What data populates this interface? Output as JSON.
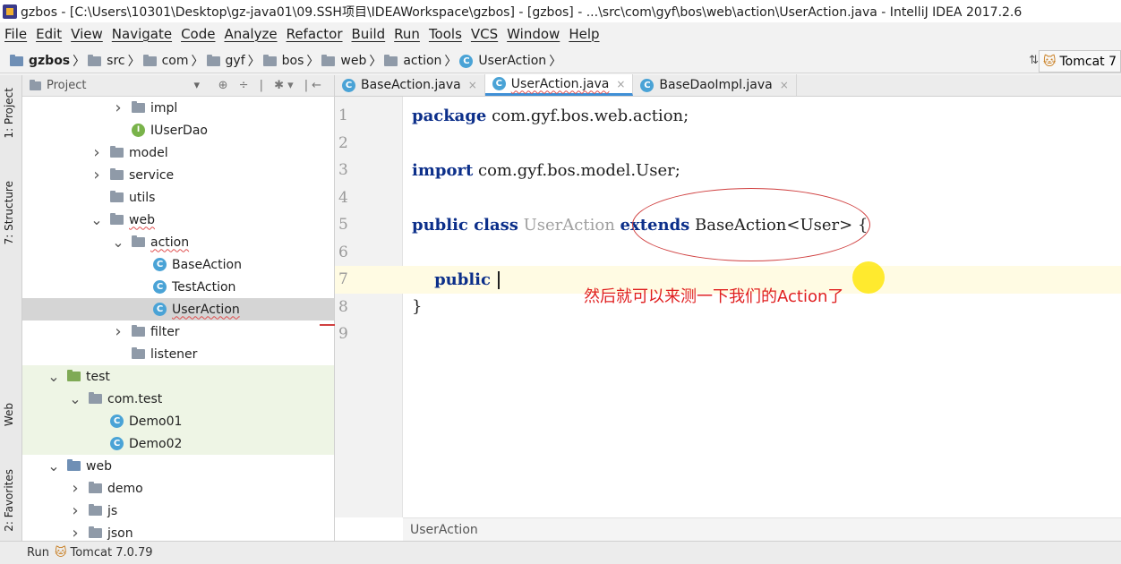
{
  "window": {
    "title": "gzbos - [C:\\Users\\10301\\Desktop\\gz-java01\\09.SSH项目\\IDEAWorkspace\\gzbos] - [gzbos] - ...\\src\\com\\gyf\\bos\\web\\action\\UserAction.java - IntelliJ IDEA 2017.2.6"
  },
  "menu": [
    "File",
    "Edit",
    "View",
    "Navigate",
    "Code",
    "Analyze",
    "Refactor",
    "Build",
    "Run",
    "Tools",
    "VCS",
    "Window",
    "Help"
  ],
  "breadcrumb": [
    "gzbos",
    "src",
    "com",
    "gyf",
    "bos",
    "web",
    "action",
    "UserAction"
  ],
  "run_config": "Tomcat 7",
  "left_tabs": {
    "project": "1: Project",
    "structure": "7: Structure",
    "web": "Web",
    "favorites": "2: Favorites"
  },
  "project_panel": {
    "title": "Project"
  },
  "tree": [
    {
      "label": "impl",
      "icon": "folder",
      "indent": 100,
      "arrow": ">"
    },
    {
      "label": "IUserDao",
      "icon": "interface",
      "indent": 122,
      "arrow": ""
    },
    {
      "label": "model",
      "icon": "folder",
      "indent": 76,
      "arrow": ">"
    },
    {
      "label": "service",
      "icon": "folder",
      "indent": 76,
      "arrow": ">"
    },
    {
      "label": "utils",
      "icon": "folder",
      "indent": 98,
      "arrow": ""
    },
    {
      "label": "web",
      "icon": "folder",
      "indent": 76,
      "arrow": "v"
    },
    {
      "label": "action",
      "icon": "folder",
      "indent": 100,
      "arrow": "v"
    },
    {
      "label": "BaseAction",
      "icon": "class",
      "indent": 146,
      "arrow": ""
    },
    {
      "label": "TestAction",
      "icon": "class",
      "indent": 146,
      "arrow": ""
    },
    {
      "label": "UserAction",
      "icon": "class",
      "indent": 146,
      "arrow": ""
    },
    {
      "label": "filter",
      "icon": "folder",
      "indent": 100,
      "arrow": ">"
    },
    {
      "label": "listener",
      "icon": "folder",
      "indent": 122,
      "arrow": ""
    },
    {
      "label": "test",
      "icon": "folder-green",
      "indent": 28,
      "arrow": "v"
    },
    {
      "label": "com.test",
      "icon": "folder",
      "indent": 52,
      "arrow": "v"
    },
    {
      "label": "Demo01",
      "icon": "class",
      "indent": 98,
      "arrow": ""
    },
    {
      "label": "Demo02",
      "icon": "class",
      "indent": 98,
      "arrow": ""
    },
    {
      "label": "web",
      "icon": "folder-blue",
      "indent": 28,
      "arrow": "v"
    },
    {
      "label": "demo",
      "icon": "folder",
      "indent": 52,
      "arrow": ">"
    },
    {
      "label": "js",
      "icon": "folder",
      "indent": 52,
      "arrow": ">"
    },
    {
      "label": "json",
      "icon": "folder",
      "indent": 52,
      "arrow": ">"
    }
  ],
  "tabs": [
    {
      "label": "BaseAction.java",
      "active": false
    },
    {
      "label": "UserAction.java",
      "active": true
    },
    {
      "label": "BaseDaoImpl.java",
      "active": false
    }
  ],
  "code": [
    {
      "n": "1",
      "parts": [
        [
          "kw",
          "package"
        ],
        [
          "",
          "com.gyf.bos.web.action;"
        ]
      ]
    },
    {
      "n": "2",
      "parts": []
    },
    {
      "n": "3",
      "parts": [
        [
          "kw",
          "import"
        ],
        [
          "",
          "com.gyf.bos.model.User;"
        ]
      ]
    },
    {
      "n": "4",
      "parts": []
    },
    {
      "n": "5",
      "parts": [
        [
          "kw",
          "public class"
        ],
        [
          "grey",
          "UserAction"
        ],
        [
          "kw",
          "extends"
        ],
        [
          "",
          "BaseAction<User> {"
        ]
      ]
    },
    {
      "n": "6",
      "parts": []
    },
    {
      "n": "7",
      "parts": [
        [
          "kw",
          "    public"
        ],
        [
          "",
          ""
        ]
      ]
    },
    {
      "n": "8",
      "parts": [
        [
          "",
          "}"
        ]
      ]
    },
    {
      "n": "9",
      "parts": []
    }
  ],
  "editor_crumb": "UserAction",
  "annotation": "然后就可以来测一下我们的Action了",
  "run_bar": {
    "label": "Run",
    "config": "Tomcat 7.0.79"
  }
}
